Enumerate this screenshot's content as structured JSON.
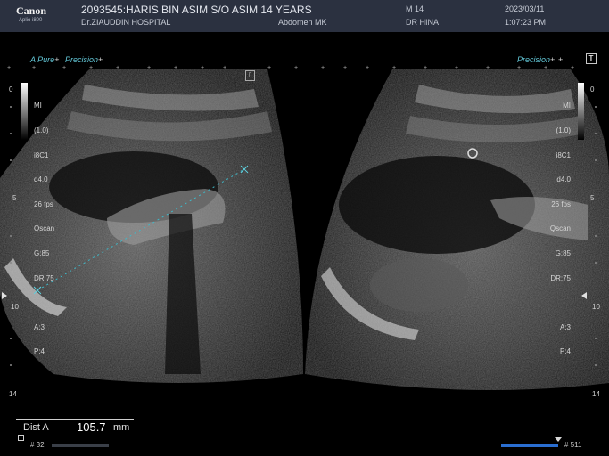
{
  "header": {
    "brand": "Canon",
    "model": "Aplio i800",
    "patient": "2093545:HARIS BIN ASIM S/O ASIM 14 YEARS",
    "hospital": "Dr.ZIAUDDIN HOSPITAL",
    "exam": "Abdomen MK",
    "mode": "M   14",
    "doctor": "DR HINA",
    "date": "2023/03/11",
    "time": "1:07:23 PM"
  },
  "tags": {
    "apure": "A Pure",
    "precision": "Precision",
    "plus": "+"
  },
  "params": {
    "mi": "MI",
    "mi_val": "(1.0)",
    "probe": "i8C1",
    "depth_setting": "d4.0",
    "fps": "26 fps",
    "qscan": "Qscan",
    "gain": "G:85",
    "dr": "DR:75",
    "a": "A:3",
    "p": "P:4"
  },
  "depth_scale": [
    "0",
    "5",
    "10",
    "14"
  ],
  "measurement": {
    "label": "Dist A",
    "value": "105.7",
    "unit": "mm"
  },
  "cine": {
    "left_frame": "# 32",
    "right_frame": "# 511"
  },
  "icons": {
    "freeze": "freeze-icon",
    "corner": "T"
  }
}
